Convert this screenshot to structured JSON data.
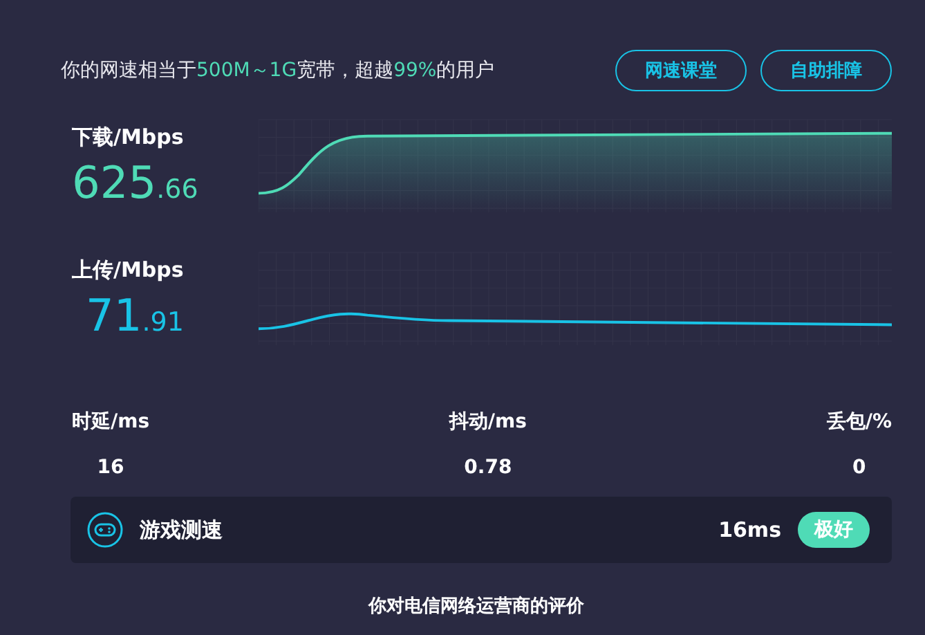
{
  "summary": [
    {
      "text": "你的网速相当于",
      "highlight": false
    },
    {
      "text": "500M～1G",
      "highlight": true
    },
    {
      "text": "宽带，超越",
      "highlight": false
    },
    {
      "text": "99%",
      "highlight": true
    },
    {
      "text": "的用户",
      "highlight": false
    }
  ],
  "buttons": [
    "网速课堂",
    "自助排障"
  ],
  "speeds": [
    {
      "kind": "download",
      "label": "下载/Mbps",
      "integer": "625",
      "decimal": ".66"
    },
    {
      "kind": "upload",
      "label": "上传/Mbps",
      "integer": "71",
      "decimal": ".91"
    }
  ],
  "metrics": [
    {
      "label": "时延/ms",
      "value": "16"
    },
    {
      "label": "抖动/ms",
      "value": "0.78"
    },
    {
      "label": "丢包/%",
      "value": "0"
    }
  ],
  "game": {
    "title": "游戏测速",
    "latency": "16ms",
    "rating": "极好"
  },
  "footer": "你对电信网络运营商的评价"
}
